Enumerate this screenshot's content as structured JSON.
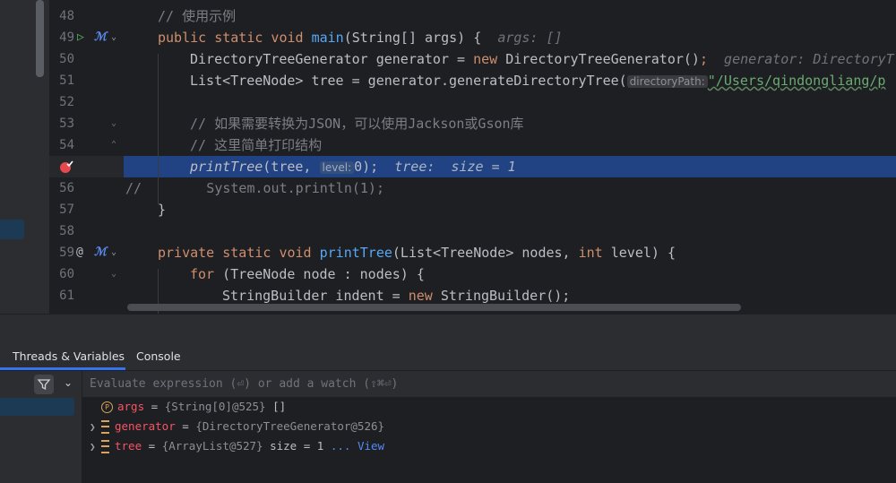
{
  "gutter": {
    "lines": [
      "48",
      "49",
      "50",
      "51",
      "52",
      "53",
      "54",
      "",
      "56",
      "57",
      "58",
      "59",
      "60",
      "61"
    ]
  },
  "code": {
    "l48": "// 使用示例",
    "l49_kw": "public static void ",
    "l49_fn": "main",
    "l49_rest": "(String[] args) {",
    "l49_hint": "args: []",
    "l50_a": "DirectoryTreeGenerator generator = ",
    "l50_kw": "new",
    "l50_b": " DirectoryTreeGenerator()",
    "l50_semi": ";",
    "l50_hint": "generator: DirectoryT",
    "l51_a": "List<TreeNode> tree = generator.generateDirectoryTree(",
    "l51_inlay": "directoryPath:",
    "l51_str": "\"/Users/qindongliang/p",
    "l53": "// 如果需要转换为JSON，可以使用Jackson或Gson库",
    "l54": "// 这里简单打印结构",
    "l55_fn": "printTree",
    "l55_a": "(tree, ",
    "l55_inlay": "level:",
    "l55_b": "0);",
    "l55_hint": "tree:  size = 1",
    "l56": "//        System.out.println(1);",
    "l57": "}",
    "l59_kw": "private static void ",
    "l59_fn": "printTree",
    "l59_a": "(List<TreeNode> nodes, ",
    "l59_kw2": "int",
    "l59_b": " level) {",
    "l60_kw": "for",
    "l60_a": " (TreeNode node : nodes) {",
    "l61_a": "StringBuilder indent = ",
    "l61_kw": "new",
    "l61_b": " StringBuilder();"
  },
  "debugger": {
    "tabs": [
      "Threads & Variables",
      "Console"
    ],
    "eval_placeholder": "Evaluate expression (⏎) or add a watch (⇧⌘⏎)",
    "variables": [
      {
        "name": "args",
        "value": "{String[0]@525}",
        "extra": "[]",
        "kind": "param"
      },
      {
        "name": "generator",
        "value": "{DirectoryTreeGenerator@526}",
        "extra": "",
        "kind": "field"
      },
      {
        "name": "tree",
        "value": "{ArrayList@527}",
        "extra": "size = 1",
        "link": "... View",
        "kind": "field"
      }
    ]
  },
  "colors": {
    "accent": "#3574f0",
    "highlight_line": "#214283",
    "keyword": "#cf8e6d",
    "function": "#56a8f5",
    "variable_name": "#f75464"
  }
}
